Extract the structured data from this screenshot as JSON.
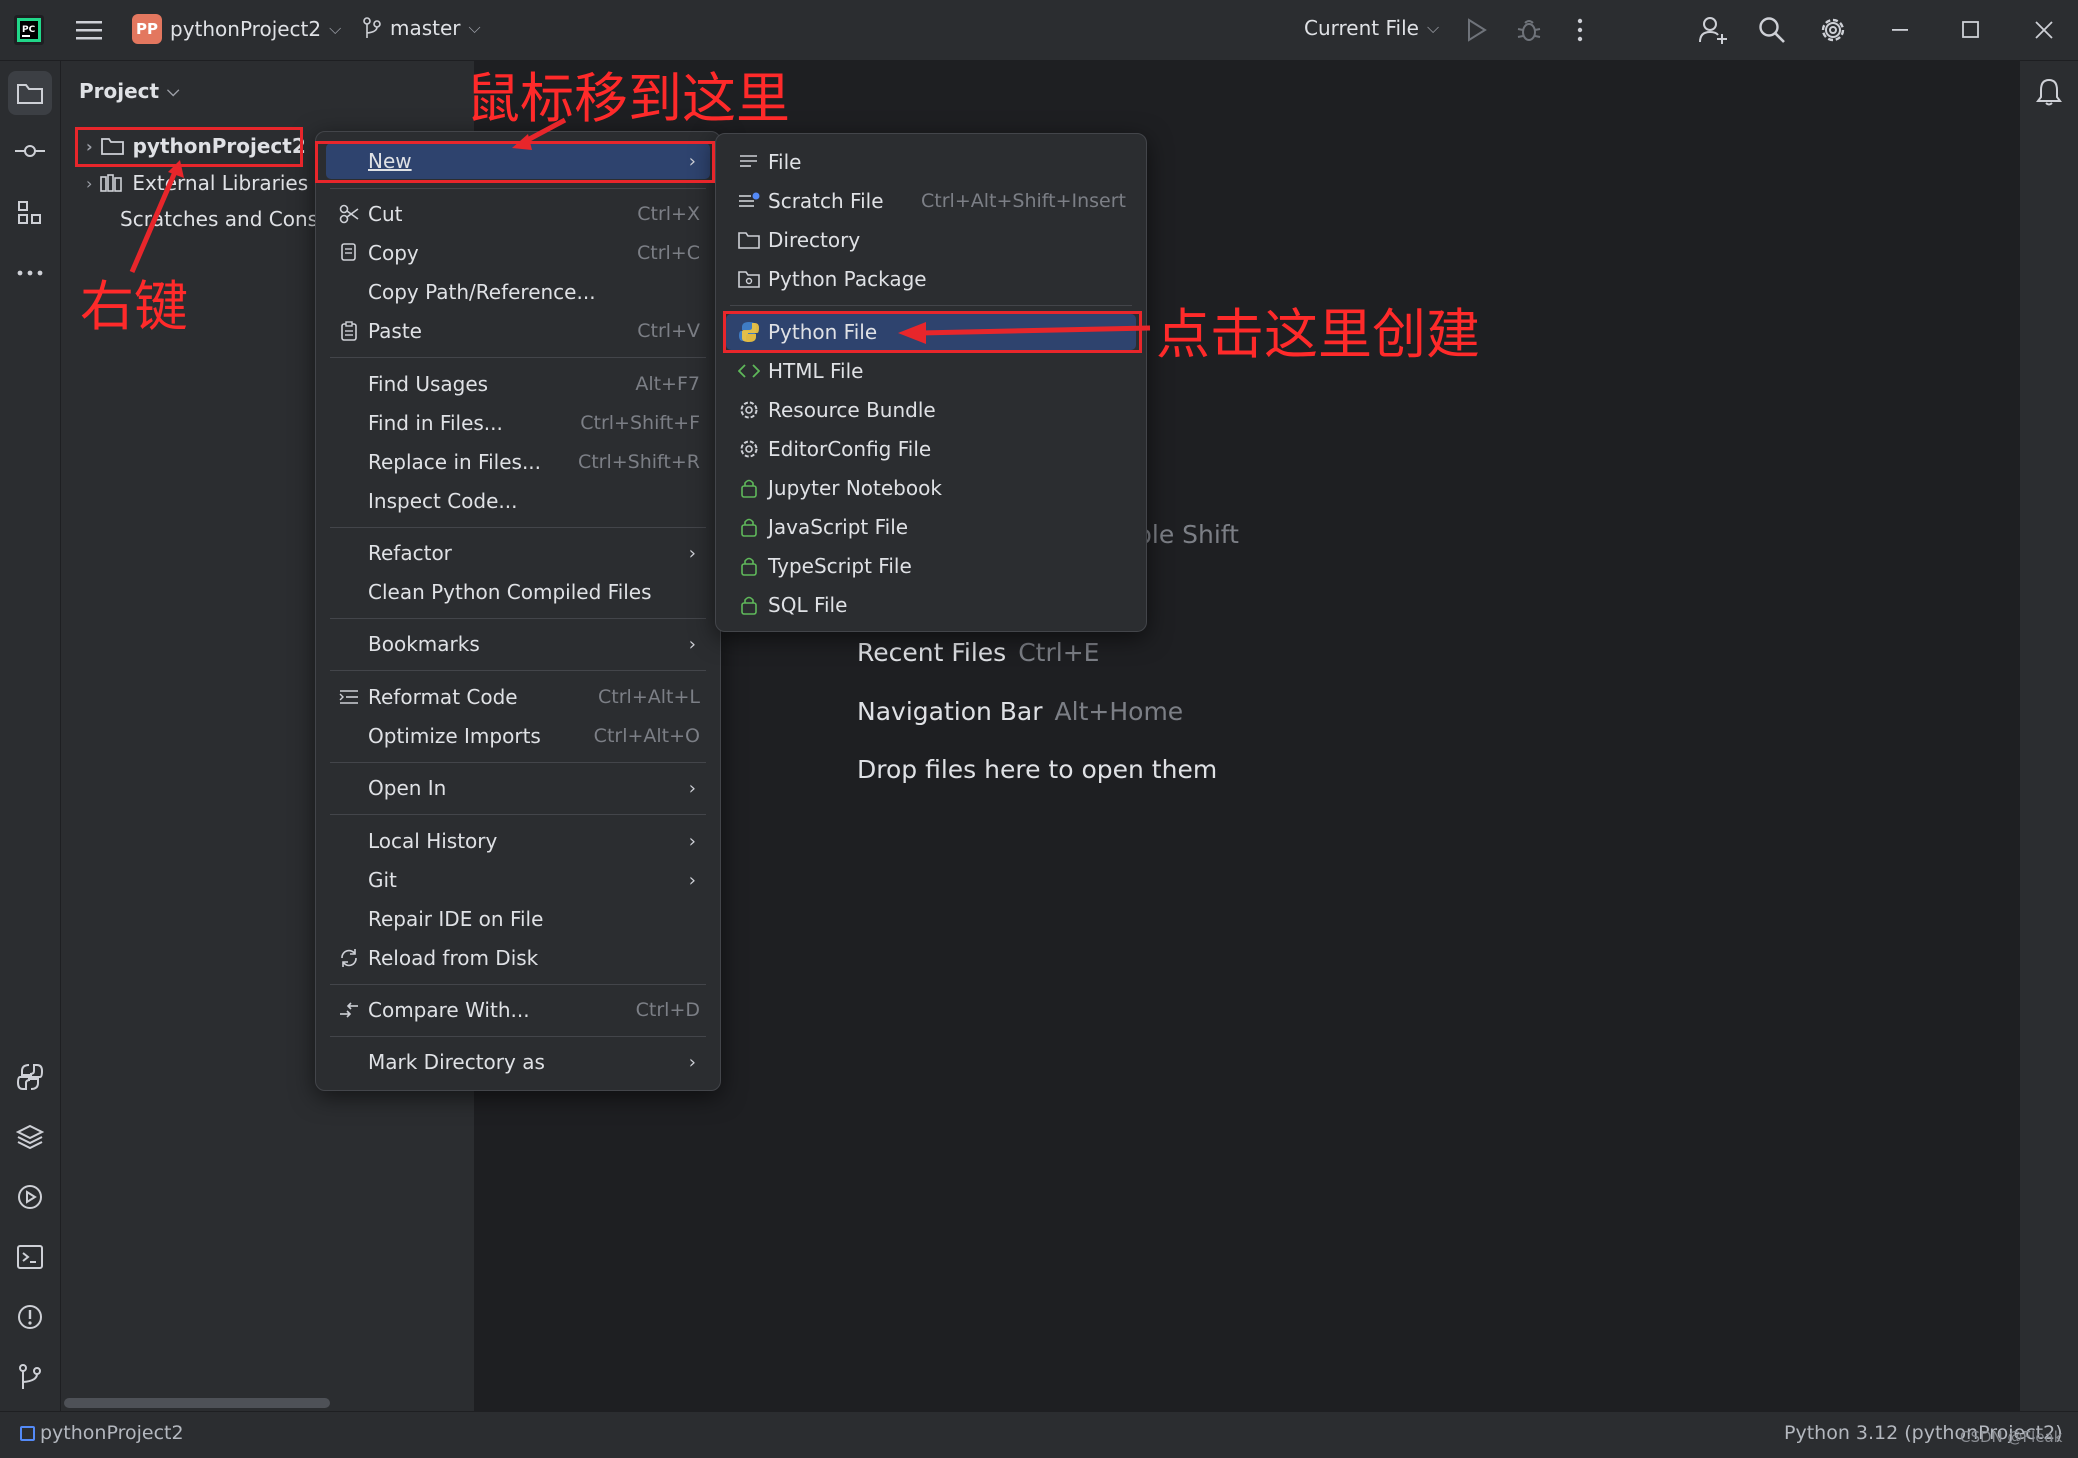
{
  "titlebar": {
    "project_badge": "PP",
    "project_name": "pythonProject2",
    "branch": "master",
    "run_config": "Current File"
  },
  "project_pane": {
    "title": "Project",
    "tree": [
      {
        "label": "pythonProject2"
      },
      {
        "label": "External Libraries"
      },
      {
        "label": "Scratches and Consoles"
      }
    ]
  },
  "context_menu": {
    "items": [
      {
        "label": "New",
        "submenu": true
      },
      {
        "label": "Cut",
        "shortcut": "Ctrl+X"
      },
      {
        "label": "Copy",
        "shortcut": "Ctrl+C"
      },
      {
        "label": "Copy Path/Reference..."
      },
      {
        "label": "Paste",
        "shortcut": "Ctrl+V"
      },
      {
        "label": "Find Usages",
        "shortcut": "Alt+F7"
      },
      {
        "label": "Find in Files...",
        "shortcut": "Ctrl+Shift+F"
      },
      {
        "label": "Replace in Files...",
        "shortcut": "Ctrl+Shift+R"
      },
      {
        "label": "Inspect Code..."
      },
      {
        "label": "Refactor",
        "submenu": true
      },
      {
        "label": "Clean Python Compiled Files"
      },
      {
        "label": "Bookmarks",
        "submenu": true
      },
      {
        "label": "Reformat Code",
        "shortcut": "Ctrl+Alt+L"
      },
      {
        "label": "Optimize Imports",
        "shortcut": "Ctrl+Alt+O"
      },
      {
        "label": "Open In",
        "submenu": true
      },
      {
        "label": "Local History",
        "submenu": true
      },
      {
        "label": "Git",
        "submenu": true
      },
      {
        "label": "Repair IDE on File"
      },
      {
        "label": "Reload from Disk"
      },
      {
        "label": "Compare With...",
        "shortcut": "Ctrl+D"
      },
      {
        "label": "Mark Directory as",
        "submenu": true
      }
    ]
  },
  "new_submenu": {
    "items": [
      {
        "label": "File"
      },
      {
        "label": "Scratch File",
        "shortcut": "Ctrl+Alt+Shift+Insert"
      },
      {
        "label": "Directory"
      },
      {
        "label": "Python Package"
      },
      {
        "label": "Python File"
      },
      {
        "label": "HTML File"
      },
      {
        "label": "Resource Bundle"
      },
      {
        "label": "EditorConfig File"
      },
      {
        "label": "Jupyter Notebook"
      },
      {
        "label": "JavaScript File"
      },
      {
        "label": "TypeScript File"
      },
      {
        "label": "SQL File"
      }
    ]
  },
  "welcome": {
    "partial_hint": "ble Shift",
    "recent_files": "Recent Files",
    "recent_files_key": "Ctrl+E",
    "navigation_bar": "Navigation Bar",
    "navigation_bar_key": "Alt+Home",
    "drop_files": "Drop files here to open them"
  },
  "annotations": {
    "move_here": "鼠标移到这里",
    "right_click": "右键",
    "click_create": "点击这里创建"
  },
  "statusbar": {
    "project": "pythonProject2",
    "interpreter": "Python 3.12 (pythonProject2)",
    "watermark": "CSDN @Fleak"
  },
  "colors": {
    "accent": "#2e436e",
    "annotation_red": "#e8262b",
    "background": "#1e1f22",
    "panel": "#2b2d30"
  }
}
